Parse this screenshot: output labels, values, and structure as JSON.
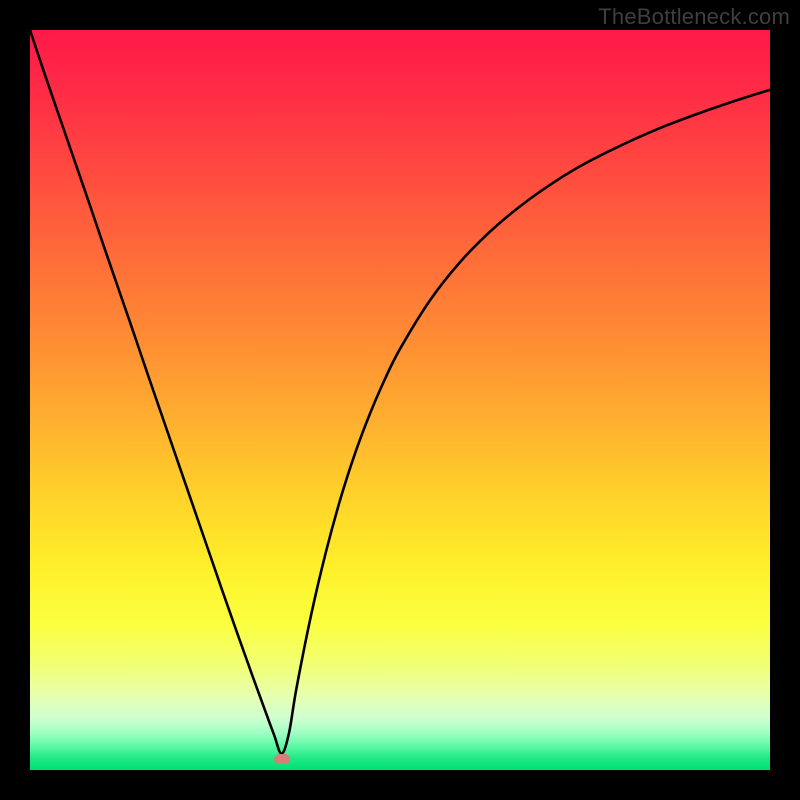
{
  "watermark": "TheBottleneck.com",
  "chart_data": {
    "type": "line",
    "title": "",
    "xlabel": "",
    "ylabel": "",
    "xlim": [
      0,
      100
    ],
    "ylim": [
      0,
      100
    ],
    "grid": false,
    "legend": false,
    "notch_x": 34,
    "marker": {
      "x": 34,
      "y": 1.5,
      "color": "#d57f77"
    },
    "series": [
      {
        "name": "bottleneck-curve",
        "color": "#000000",
        "x": [
          0,
          2,
          4,
          6,
          8,
          10,
          12,
          14,
          16,
          18,
          20,
          22,
          24,
          26,
          28,
          30,
          32,
          33,
          34,
          35,
          36,
          38,
          40,
          42,
          44,
          46,
          48,
          50,
          54,
          58,
          62,
          66,
          70,
          74,
          78,
          82,
          86,
          90,
          94,
          98,
          100
        ],
        "y": [
          100,
          94,
          88.2,
          82.4,
          76.6,
          70.7,
          64.9,
          59.1,
          53.2,
          47.4,
          41.6,
          35.8,
          30,
          24.2,
          18.5,
          12.9,
          7.4,
          4.7,
          2.2,
          5,
          11,
          21,
          29.5,
          36.8,
          43,
          48.3,
          52.9,
          56.9,
          63.4,
          68.5,
          72.6,
          76,
          78.9,
          81.4,
          83.5,
          85.4,
          87.1,
          88.6,
          90,
          91.3,
          91.9
        ]
      }
    ],
    "gradient_stops": [
      {
        "pos": 0,
        "color": "#ff1a49"
      },
      {
        "pos": 8,
        "color": "#ff2b46"
      },
      {
        "pos": 18,
        "color": "#ff4740"
      },
      {
        "pos": 30,
        "color": "#ff6a3a"
      },
      {
        "pos": 41,
        "color": "#ff8a34"
      },
      {
        "pos": 53,
        "color": "#ffb02f"
      },
      {
        "pos": 63,
        "color": "#ffd22a"
      },
      {
        "pos": 72,
        "color": "#ffee2a"
      },
      {
        "pos": 80,
        "color": "#fbff3d"
      },
      {
        "pos": 86,
        "color": "#f1ff77"
      },
      {
        "pos": 90,
        "color": "#e7ffb0"
      },
      {
        "pos": 93,
        "color": "#cfffd0"
      },
      {
        "pos": 95,
        "color": "#9fffc3"
      },
      {
        "pos": 97,
        "color": "#56f7a2"
      },
      {
        "pos": 98.5,
        "color": "#1de884"
      },
      {
        "pos": 100,
        "color": "#00e072"
      }
    ]
  }
}
